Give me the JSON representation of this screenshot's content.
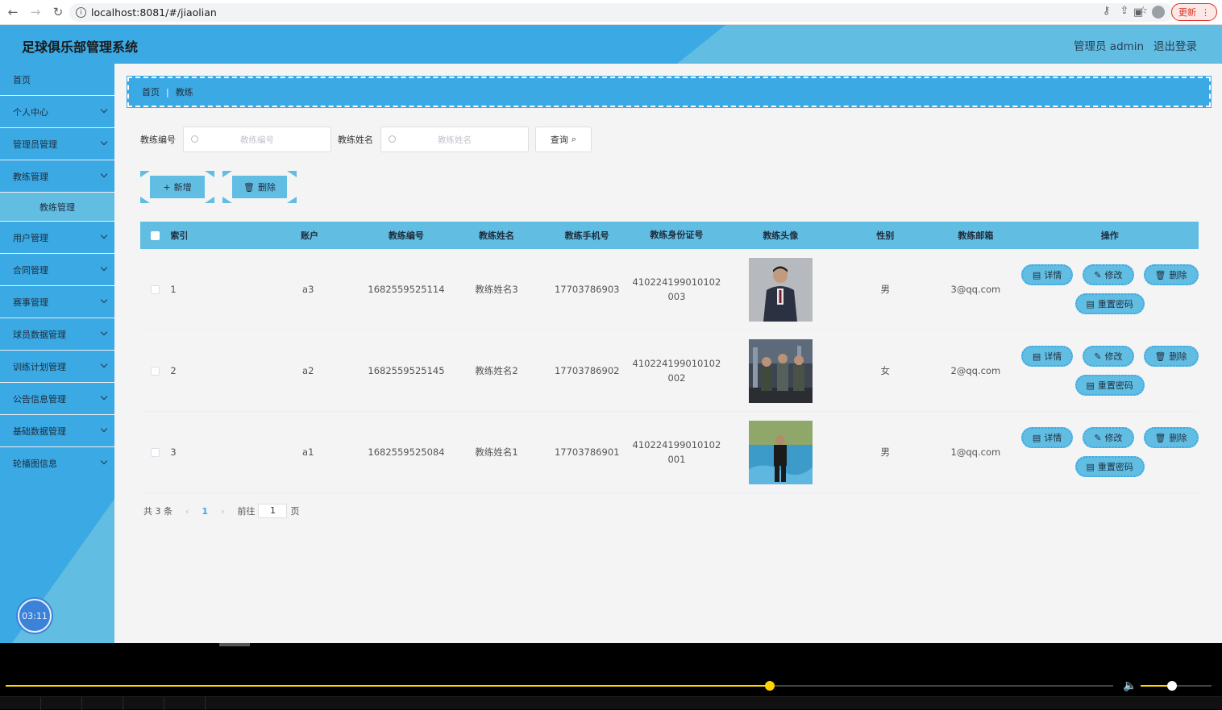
{
  "browser": {
    "url": "localhost:8081/#/jiaolian",
    "update_label": "更新"
  },
  "header": {
    "title": "足球俱乐部管理系统",
    "user": "管理员 admin",
    "logout": "退出登录"
  },
  "sidebar": {
    "items": [
      {
        "label": "首页",
        "chevron": false
      },
      {
        "label": "个人中心",
        "chevron": true
      },
      {
        "label": "管理员管理",
        "chevron": true
      },
      {
        "label": "教练管理",
        "chevron": true
      }
    ],
    "sub_item": "教练管理",
    "items_after": [
      {
        "label": "用户管理"
      },
      {
        "label": "合同管理"
      },
      {
        "label": "赛事管理"
      },
      {
        "label": "球员数据管理"
      },
      {
        "label": "训练计划管理"
      },
      {
        "label": "公告信息管理"
      },
      {
        "label": "基础数据管理"
      },
      {
        "label": "轮播图信息"
      }
    ],
    "timer": "03:11"
  },
  "breadcrumb": {
    "home": "首页",
    "current": "教练"
  },
  "search": {
    "label_no": "教练编号",
    "placeholder_no": "教练编号",
    "label_name": "教练姓名",
    "placeholder_name": "教练姓名",
    "query_label": "查询"
  },
  "actions": {
    "add_label": "新增",
    "delete_label": "删除"
  },
  "table": {
    "headers": [
      "索引",
      "账户",
      "教练编号",
      "教练姓名",
      "教练手机号",
      "教练身份证号",
      "教练头像",
      "性别",
      "教练邮箱",
      "操作"
    ],
    "rows": [
      {
        "index": "1",
        "account": "a3",
        "no": "1682559525114",
        "name": "教练姓名3",
        "phone": "17703786903",
        "id_line1": "410224199010102",
        "id_line2": "003",
        "sex": "男",
        "email": "3@qq.com"
      },
      {
        "index": "2",
        "account": "a2",
        "no": "1682559525145",
        "name": "教练姓名2",
        "phone": "17703786902",
        "id_line1": "410224199010102",
        "id_line2": "002",
        "sex": "女",
        "email": "2@qq.com"
      },
      {
        "index": "3",
        "account": "a1",
        "no": "1682559525084",
        "name": "教练姓名1",
        "phone": "17703786901",
        "id_line1": "410224199010102",
        "id_line2": "001",
        "sex": "男",
        "email": "1@qq.com"
      }
    ],
    "op_labels": {
      "detail": "详情",
      "edit": "修改",
      "delete": "删除",
      "reset": "重置密码"
    }
  },
  "pager": {
    "total": "共 3 条",
    "current": "1",
    "goto": "前往",
    "goto_value": "1",
    "page_unit": "页"
  },
  "player": {
    "progress": 0.69,
    "volume": 0.44
  },
  "colors": {
    "primary": "#3aa9e4",
    "secondary": "#62bde2",
    "progress": "#ffd400"
  }
}
